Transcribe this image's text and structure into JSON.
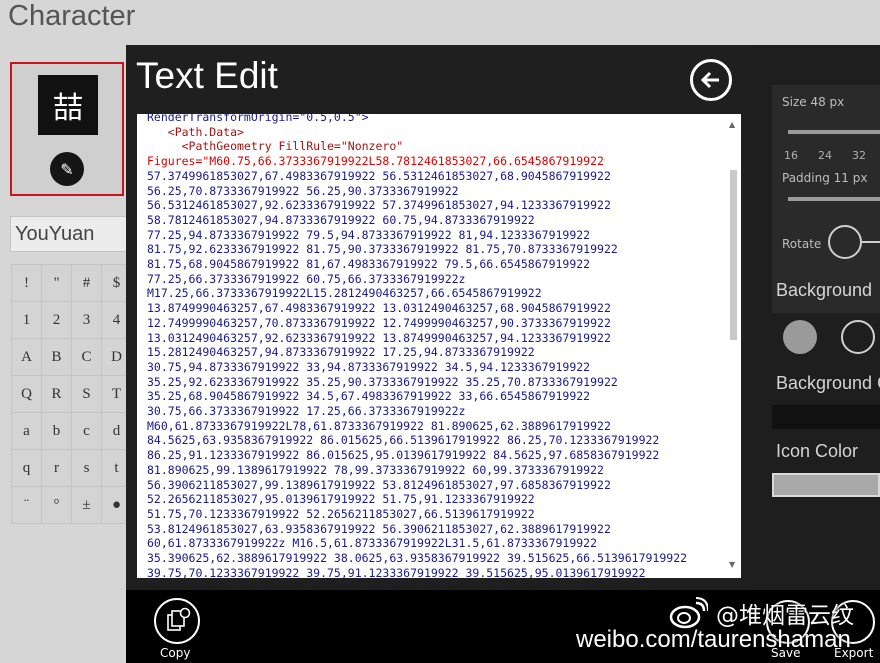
{
  "app": {
    "title": "Character"
  },
  "character": {
    "glyph": "喆",
    "font": "YouYuan"
  },
  "glyph_grid": [
    "!",
    "\"",
    "#",
    "$",
    "1",
    "2",
    "3",
    "4",
    "A",
    "B",
    "C",
    "D",
    "Q",
    "R",
    "S",
    "T",
    "a",
    "b",
    "c",
    "d",
    "q",
    "r",
    "s",
    "t",
    "¨",
    "°",
    "±",
    "●"
  ],
  "right_panel": {
    "size_label": "Size  48  px",
    "ticks": [
      "16",
      "24",
      "32"
    ],
    "padding_label": "Padding  11 px",
    "rotate_label": "Rotate",
    "background_label": "Background",
    "background_color_label": "Background C",
    "icon_color_label": "Icon Color",
    "colors": {
      "panel": "#1e1e1e",
      "card": "#2a2a2a",
      "circle_gray": "#9a9a9a",
      "swatch_dark": "#111111",
      "swatch_light": "#a8a8a8"
    }
  },
  "dialog": {
    "title": "Text Edit",
    "back_icon": "back-arrow-icon",
    "lines": [
      {
        "t": "plain",
        "text": "RenderTransformOrigin=\"0.5,0.5\">"
      },
      {
        "t": "tag",
        "text": "   <Path.Data>"
      },
      {
        "t": "geom",
        "text": "     <PathGeometry FillRule=\"Nonzero\""
      },
      {
        "t": "attr",
        "text": "Figures=\"M60.75,66.3733367919922L58.7812461853027,66.6545867919922"
      },
      {
        "t": "plain",
        "text": "57.3749961853027,67.4983367919922 56.5312461853027,68.9045867919922"
      },
      {
        "t": "plain",
        "text": "56.25,70.8733367919922 56.25,90.3733367919922"
      },
      {
        "t": "plain",
        "text": "56.5312461853027,92.6233367919922 57.3749961853027,94.1233367919922"
      },
      {
        "t": "plain",
        "text": "58.7812461853027,94.8733367919922 60.75,94.8733367919922"
      },
      {
        "t": "plain",
        "text": "77.25,94.8733367919922 79.5,94.8733367919922 81,94.1233367919922"
      },
      {
        "t": "plain",
        "text": "81.75,92.6233367919922 81.75,90.3733367919922 81.75,70.8733367919922"
      },
      {
        "t": "plain",
        "text": "81.75,68.9045867919922 81,67.4983367919922 79.5,66.6545867919922"
      },
      {
        "t": "plain",
        "text": "77.25,66.3733367919922 60.75,66.3733367919922z"
      },
      {
        "t": "plain",
        "text": "M17.25,66.3733367919922L15.2812490463257,66.6545867919922"
      },
      {
        "t": "plain",
        "text": "13.8749990463257,67.4983367919922 13.0312490463257,68.9045867919922"
      },
      {
        "t": "plain",
        "text": "12.7499990463257,70.8733367919922 12.7499990463257,90.3733367919922"
      },
      {
        "t": "plain",
        "text": "13.0312490463257,92.6233367919922 13.8749990463257,94.1233367919922"
      },
      {
        "t": "plain",
        "text": "15.2812490463257,94.8733367919922 17.25,94.8733367919922"
      },
      {
        "t": "plain",
        "text": "30.75,94.8733367919922 33,94.8733367919922 34.5,94.1233367919922"
      },
      {
        "t": "plain",
        "text": "35.25,92.6233367919922 35.25,90.3733367919922 35.25,70.8733367919922"
      },
      {
        "t": "plain",
        "text": "35.25,68.9045867919922 34.5,67.4983367919922 33,66.6545867919922"
      },
      {
        "t": "plain",
        "text": "30.75,66.3733367919922 17.25,66.3733367919922z"
      },
      {
        "t": "plain",
        "text": "M60,61.8733367919922L78,61.8733367919922 81.890625,62.3889617919922"
      },
      {
        "t": "plain",
        "text": "84.5625,63.9358367919922 86.015625,66.5139617919922 86.25,70.1233367919922"
      },
      {
        "t": "plain",
        "text": "86.25,91.1233367919922 86.015625,95.0139617919922 84.5625,97.6858367919922"
      },
      {
        "t": "plain",
        "text": "81.890625,99.1389617919922 78,99.3733367919922 60,99.3733367919922"
      },
      {
        "t": "plain",
        "text": "56.3906211853027,99.1389617919922 53.8124961853027,97.6858367919922"
      },
      {
        "t": "plain",
        "text": "52.2656211853027,95.0139617919922 51.75,91.1233367919922"
      },
      {
        "t": "plain",
        "text": "51.75,70.1233367919922 52.2656211853027,66.5139617919922"
      },
      {
        "t": "plain",
        "text": "53.8124961853027,63.9358367919922 56.3906211853027,62.3889617919922"
      },
      {
        "t": "plain",
        "text": "60,61.8733367919922z M16.5,61.8733367919922L31.5,61.8733367919922"
      },
      {
        "t": "plain",
        "text": "35.390625,62.3889617919922 38.0625,63.9358367919922 39.515625,66.5139617919922"
      },
      {
        "t": "plain",
        "text": "39.75,70.1233367919922 39.75,91.1233367919922 39.515625,95.0139617919922"
      }
    ]
  },
  "appbar": {
    "copy_label": "Copy",
    "save_label": "Save",
    "export_label": "Export",
    "copy_icon": "copy-icon"
  },
  "watermark": {
    "handle": "@堆烟雷云纹",
    "url": "weibo.com/taurenshaman",
    "logo_icon": "weibo-logo-icon"
  }
}
